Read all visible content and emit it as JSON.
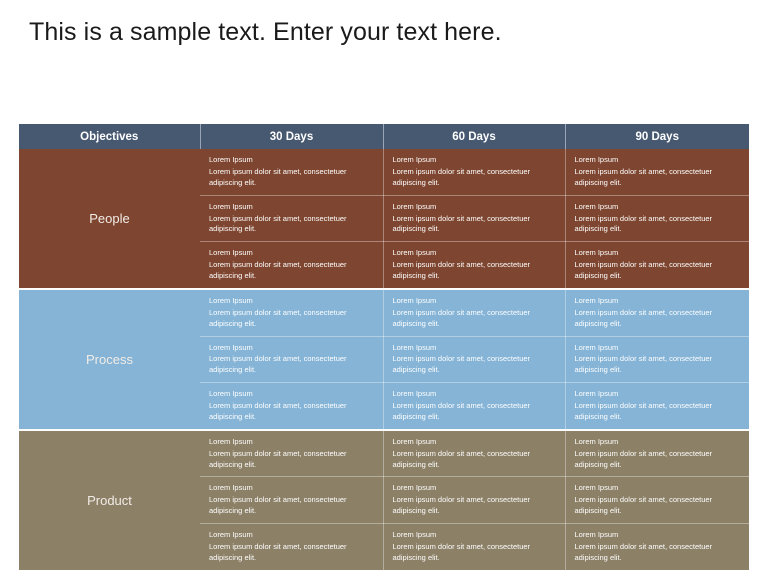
{
  "slide": {
    "title": "This is a sample text. Enter your text here."
  },
  "colors": {
    "header_bg": "#475871",
    "people_bg": "#7e4630",
    "process_bg": "#85b4d6",
    "product_bg": "#8c8067",
    "cell_text": "#ffffff",
    "title_text": "#1a1a1a",
    "slide_bg": "#ffffff"
  },
  "table": {
    "headers": [
      "Objectives",
      "30 Days",
      "60 Days",
      "90 Days"
    ],
    "cell_title": "Lorem Ipsum",
    "cell_body": "Lorem ipsum dolor sit amet, consectetuer adipiscing elit.",
    "rows": [
      {
        "label": "People",
        "subrows": [
          {
            "cells": [
              {
                "title": "Lorem Ipsum",
                "body": "Lorem ipsum dolor sit amet, consectetuer adipiscing elit."
              },
              {
                "title": "Lorem Ipsum",
                "body": "Lorem ipsum dolor sit amet, consectetuer adipiscing elit."
              },
              {
                "title": "Lorem Ipsum",
                "body": "Lorem ipsum dolor sit amet, consectetuer adipiscing elit."
              }
            ]
          },
          {
            "cells": [
              {
                "title": "Lorem Ipsum",
                "body": "Lorem ipsum dolor sit amet, consectetuer adipiscing elit."
              },
              {
                "title": "Lorem Ipsum",
                "body": "Lorem ipsum dolor sit amet, consectetuer adipiscing elit."
              },
              {
                "title": "Lorem Ipsum",
                "body": "Lorem ipsum dolor sit amet, consectetuer adipiscing elit."
              }
            ]
          },
          {
            "cells": [
              {
                "title": "Lorem Ipsum",
                "body": "Lorem ipsum dolor sit amet, consectetuer adipiscing elit."
              },
              {
                "title": "Lorem Ipsum",
                "body": "Lorem ipsum dolor sit amet, consectetuer adipiscing elit."
              },
              {
                "title": "Lorem Ipsum",
                "body": "Lorem ipsum dolor sit amet, consectetuer adipiscing elit."
              }
            ]
          }
        ]
      },
      {
        "label": "Process",
        "subrows": [
          {
            "cells": [
              {
                "title": "Lorem Ipsum",
                "body": "Lorem ipsum dolor sit amet, consectetuer adipiscing elit."
              },
              {
                "title": "Lorem Ipsum",
                "body": "Lorem ipsum dolor sit amet, consectetuer adipiscing elit."
              },
              {
                "title": "Lorem Ipsum",
                "body": "Lorem ipsum dolor sit amet, consectetuer adipiscing elit."
              }
            ]
          },
          {
            "cells": [
              {
                "title": "Lorem Ipsum",
                "body": "Lorem ipsum dolor sit amet, consectetuer adipiscing elit."
              },
              {
                "title": "Lorem Ipsum",
                "body": "Lorem ipsum dolor sit amet, consectetuer adipiscing elit."
              },
              {
                "title": "Lorem Ipsum",
                "body": "Lorem ipsum dolor sit amet, consectetuer adipiscing elit."
              }
            ]
          },
          {
            "cells": [
              {
                "title": "Lorem Ipsum",
                "body": "Lorem ipsum dolor sit amet, consectetuer adipiscing elit."
              },
              {
                "title": "Lorem Ipsum",
                "body": "Lorem ipsum dolor sit amet, consectetuer adipiscing elit."
              },
              {
                "title": "Lorem Ipsum",
                "body": "Lorem ipsum dolor sit amet, consectetuer adipiscing elit."
              }
            ]
          }
        ]
      },
      {
        "label": "Product",
        "subrows": [
          {
            "cells": [
              {
                "title": "Lorem Ipsum",
                "body": "Lorem ipsum dolor sit amet, consectetuer adipiscing elit."
              },
              {
                "title": "Lorem Ipsum",
                "body": "Lorem ipsum dolor sit amet, consectetuer adipiscing elit."
              },
              {
                "title": "Lorem Ipsum",
                "body": "Lorem ipsum dolor sit amet, consectetuer adipiscing elit."
              }
            ]
          },
          {
            "cells": [
              {
                "title": "Lorem Ipsum",
                "body": "Lorem ipsum dolor sit amet, consectetuer adipiscing elit."
              },
              {
                "title": "Lorem Ipsum",
                "body": "Lorem ipsum dolor sit amet, consectetuer adipiscing elit."
              },
              {
                "title": "Lorem Ipsum",
                "body": "Lorem ipsum dolor sit amet, consectetuer adipiscing elit."
              }
            ]
          },
          {
            "cells": [
              {
                "title": "Lorem Ipsum",
                "body": "Lorem ipsum dolor sit amet, consectetuer adipiscing elit."
              },
              {
                "title": "Lorem Ipsum",
                "body": "Lorem ipsum dolor sit amet, consectetuer adipiscing elit."
              },
              {
                "title": "Lorem Ipsum",
                "body": "Lorem ipsum dolor sit amet, consectetuer adipiscing elit."
              }
            ]
          }
        ]
      }
    ]
  }
}
